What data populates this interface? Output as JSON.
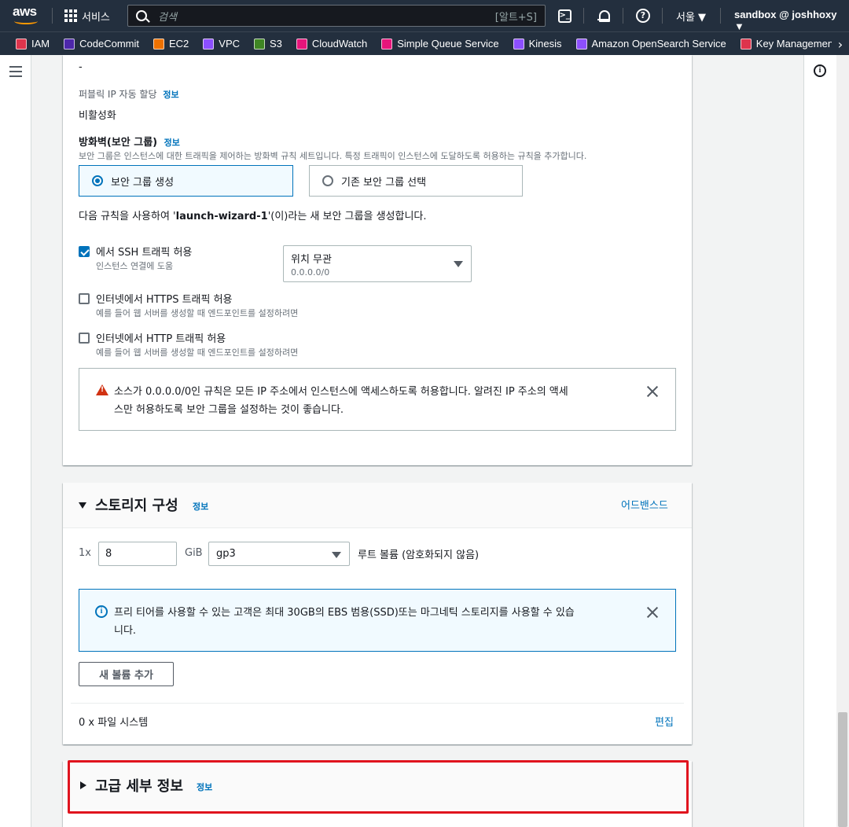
{
  "topnav": {
    "logo": "aws",
    "services_label": "서비스",
    "search_placeholder": "검색",
    "search_shortcut": "[알트+S]",
    "cloudshell_icon": "cloudshell-icon",
    "region": "서울 ▼",
    "account": "sandbox @ joshhoxy ▼"
  },
  "favorites": [
    {
      "label": "IAM",
      "color": "#dd344c"
    },
    {
      "label": "CodeCommit",
      "color": "#4d27aa"
    },
    {
      "label": "EC2",
      "color": "#ed7100"
    },
    {
      "label": "VPC",
      "color": "#8c4fff"
    },
    {
      "label": "S3",
      "color": "#3f8624"
    },
    {
      "label": "CloudWatch",
      "color": "#e7157b"
    },
    {
      "label": "Simple Queue Service",
      "color": "#e7157b"
    },
    {
      "label": "Kinesis",
      "color": "#8c4fff"
    },
    {
      "label": "Amazon OpenSearch Service",
      "color": "#8c4fff"
    },
    {
      "label": "Key Management Servic",
      "color": "#dd344c"
    }
  ],
  "network": {
    "dash": "-",
    "public_ip_label": "퍼블릭 IP 자동 할당",
    "info": "정보",
    "public_ip_value": "비활성화",
    "firewall_title": "방화벽(보안 그룹)",
    "firewall_desc": "보안 그룹은 인스턴스에 대한 트래픽을 제어하는 방화벽 규칙 세트입니다. 특정 트래픽이 인스턴스에 도달하도록 허용하는 규칙을 추가합니다.",
    "option_create": "보안 그룹 생성",
    "option_existing": "기존 보안 그룹 선택",
    "create_note_prefix": "다음 규칙을 사용하여 '",
    "create_note_name": "launch-wizard-1",
    "create_note_suffix": "'(이)라는 새 보안 그룹을 생성합니다.",
    "ssh_label": "에서 SSH 트래픽 허용",
    "ssh_desc": "인스턴스 연결에 도움",
    "source_select": "위치 무관",
    "source_cidr": "0.0.0.0/0",
    "https_label": "인터넷에서 HTTPS 트래픽 허용",
    "https_desc": "예를 들어 웹 서버를 생성할 때 엔드포인트를 설정하려면",
    "http_label": "인터넷에서 HTTP 트래픽 허용",
    "http_desc": "예를 들어 웹 서버를 생성할 때 엔드포인트를 설정하려면",
    "warning_line1": "소스가 0.0.0.0/0인 규칙은 모든 IP 주소에서 인스턴스에 액세스하도록 허용합니다. 알려진 IP 주소의 액세",
    "warning_line2": "스만 허용하도록 보안 그룹을 설정하는 것이 좋습니다."
  },
  "storage": {
    "title": "스토리지 구성",
    "info": "정보",
    "advanced": "어드밴스드",
    "count": "1x",
    "size": "8",
    "unit": "GiB",
    "volume_type": "gp3",
    "root_note": "루트 볼륨  (암호화되지 않음)",
    "free_tier_line1": "프리 티어를 사용할 수 있는 고객은 최대 30GB의 EBS 범용(SSD)또는 마그네틱 스토리지를 사용할 수 있습",
    "free_tier_line2": "니다.",
    "add_volume": "새 볼륨 추가",
    "file_systems": "0 x 파일 시스템",
    "edit": "편집"
  },
  "advanced": {
    "title": "고급 세부 정보",
    "info": "정보"
  }
}
